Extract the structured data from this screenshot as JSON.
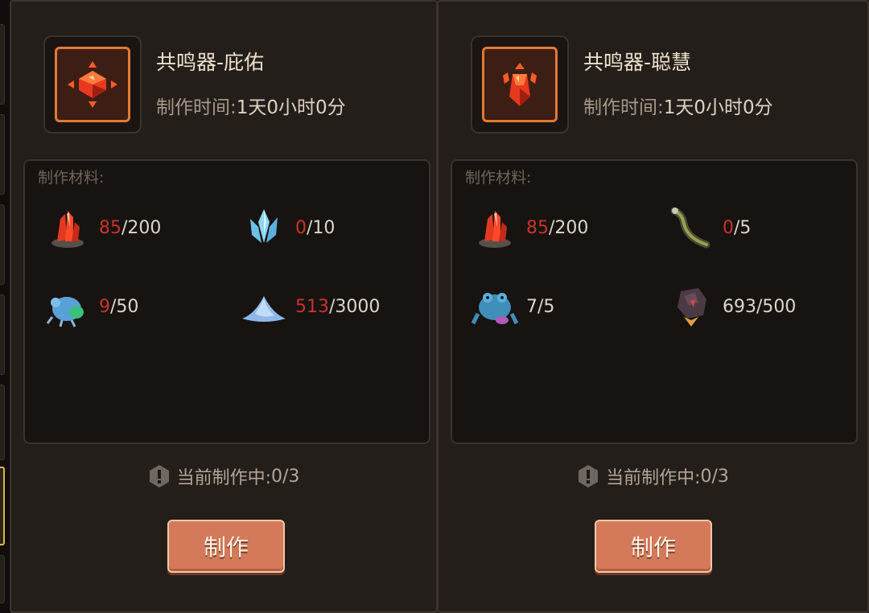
{
  "colors": {
    "panel_bg": "#241e1b",
    "accent_orange": "#e07a34",
    "insufficient_red": "#c8332b",
    "button_bg": "#d47a5a"
  },
  "recipes": [
    {
      "icon": "red-gem-resonator-icon",
      "name": "共鸣器-庇佑",
      "time_label": "制作时间:",
      "time_value": "1天0小时0分",
      "materials_title": "制作材料:",
      "materials": [
        {
          "icon": "red-crystal-ore-icon",
          "have": "85",
          "need": "/200",
          "insufficient": true
        },
        {
          "icon": "blue-crystal-cluster-icon",
          "have": "0",
          "need": "/10",
          "insufficient": true
        },
        {
          "icon": "blue-beetle-icon",
          "have": "9",
          "need": "/50",
          "insufficient": true
        },
        {
          "icon": "blue-powder-pile-icon",
          "have": "513",
          "need": "/3000",
          "insufficient": true
        }
      ],
      "status_label": "当前制作中:",
      "status_value": "0/3",
      "button_label": "制作"
    },
    {
      "icon": "red-idol-resonator-icon",
      "name": "共鸣器-聪慧",
      "time_label": "制作时间:",
      "time_value": "1天0小时0分",
      "materials_title": "制作材料:",
      "materials": [
        {
          "icon": "red-crystal-ore-icon",
          "have": "85",
          "need": "/200",
          "insufficient": true
        },
        {
          "icon": "eel-icon",
          "have": "0",
          "need": "/5",
          "insufficient": true
        },
        {
          "icon": "blue-frog-creature-icon",
          "have": "7",
          "need": "/5",
          "insufficient": false
        },
        {
          "icon": "dark-ore-chunk-icon",
          "have": "693",
          "need": "/500",
          "insufficient": false
        }
      ],
      "status_label": "当前制作中:",
      "status_value": "0/3",
      "button_label": "制作"
    }
  ]
}
